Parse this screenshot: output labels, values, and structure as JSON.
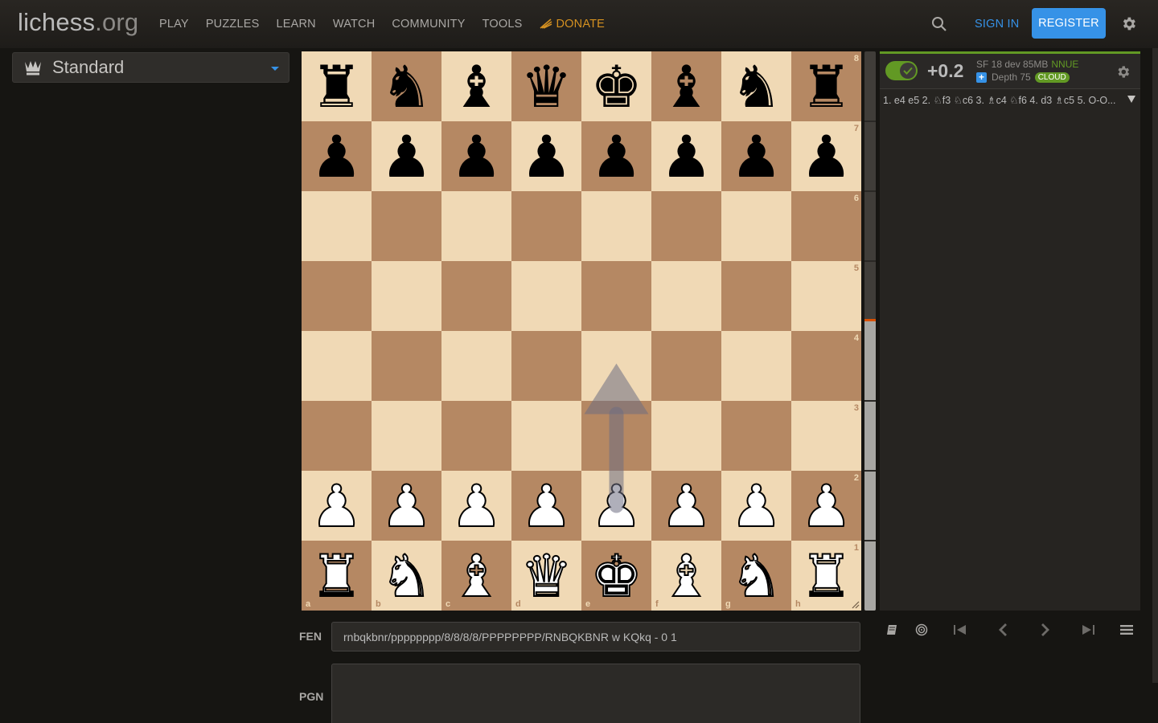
{
  "header": {
    "logo_main": "lichess",
    "logo_tld": ".org",
    "nav": [
      "PLAY",
      "PUZZLES",
      "LEARN",
      "WATCH",
      "COMMUNITY",
      "TOOLS"
    ],
    "donate": "DONATE",
    "sign_in": "SIGN IN",
    "register": "REGISTER"
  },
  "variant": {
    "selected": "Standard"
  },
  "board": {
    "fen": "rnbqkbnr/pppppppp/8/8/8/8/PPPPPPPP/RNBQKBNR w KQkq - 0 1",
    "files": [
      "a",
      "b",
      "c",
      "d",
      "e",
      "f",
      "g",
      "h"
    ],
    "ranks": [
      "8",
      "7",
      "6",
      "5",
      "4",
      "3",
      "2",
      "1"
    ],
    "arrow": {
      "from": "e2",
      "to": "e4"
    }
  },
  "eval_gauge": {
    "white_share": 0.52
  },
  "ceval": {
    "eval": "+0.2",
    "engine": "SF 18 dev 85MB",
    "nnue": "NNUE",
    "depth": "Depth 75",
    "cloud": "CLOUD",
    "pv": "1. e4 e5 2. ♘f3 ♘c6 3. ♗c4 ♘f6 4. d3 ♗c5 5. O-O..."
  },
  "fen_label": "FEN",
  "fen_value": "rnbqkbnr/pppppppp/8/8/8/8/PPPPPPPP/RNBQKBNR w KQkq - 0 1",
  "pgn_label": "PGN",
  "colors": {
    "light_square": "#f0d9b5",
    "dark_square": "#b58863",
    "accent_blue": "#3692e7",
    "accent_green": "#629924",
    "donate_orange": "#d59120"
  }
}
